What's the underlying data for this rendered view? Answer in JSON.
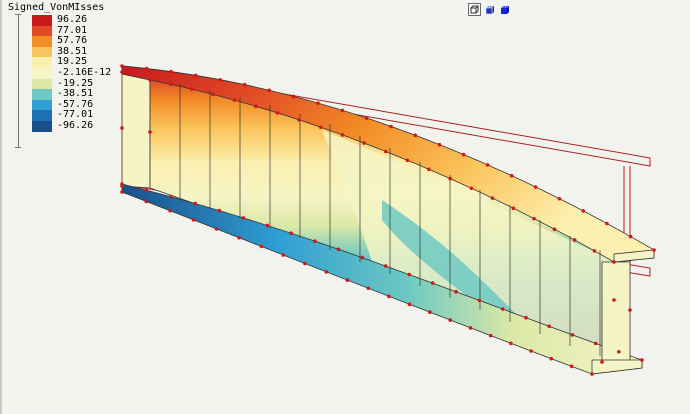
{
  "legend": {
    "title": "Signed_VonMIsses",
    "entries": [
      {
        "label": "96.26",
        "color": "#c8191c"
      },
      {
        "label": "77.01",
        "color": "#e04a25"
      },
      {
        "label": "57.76",
        "color": "#f28d26"
      },
      {
        "label": "38.51",
        "color": "#fbc55e"
      },
      {
        "label": "19.25",
        "color": "#fcf0b0"
      },
      {
        "label": "-2.16E-12",
        "color": "#f5f4c6"
      },
      {
        "label": "-19.25",
        "color": "#dbe8a6"
      },
      {
        "label": "-38.51",
        "color": "#6ec9c2"
      },
      {
        "label": "-57.76",
        "color": "#2f9ed3"
      },
      {
        "label": "-77.01",
        "color": "#1f6fb4"
      },
      {
        "label": "-96.26",
        "color": "#1a4f8a"
      }
    ]
  },
  "toolbar": {
    "buttons": [
      {
        "name": "view-front-button",
        "icon": "cube-outline-icon"
      },
      {
        "name": "view-iso-button",
        "icon": "cube-shaded-icon"
      },
      {
        "name": "view-solid-button",
        "icon": "cube-solid-icon"
      }
    ]
  },
  "colors": {
    "background": "#f2f3ef",
    "outline": "#b02020",
    "node": "#d01818"
  }
}
